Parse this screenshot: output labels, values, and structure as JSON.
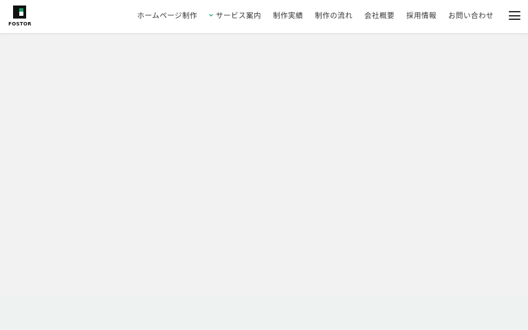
{
  "header": {
    "logo_text": "FOSTOR",
    "nav": [
      {
        "label": "ホームページ制作",
        "icon": ""
      },
      {
        "label": "サービス案内",
        "icon": "chevron-down-icon"
      },
      {
        "label": "制作実績",
        "icon": ""
      },
      {
        "label": "制作の流れ",
        "icon": ""
      },
      {
        "label": "会社概要",
        "icon": ""
      },
      {
        "label": "採用情報",
        "icon": ""
      },
      {
        "label": "お問い合わせ",
        "icon": ""
      }
    ],
    "menu_icon": "hamburger-menu-icon"
  },
  "colors": {
    "accent": "#1aa36a",
    "page_bg": "#f2f2f2",
    "section_bg": "#eef3f2",
    "header_bg": "#ffffff"
  }
}
